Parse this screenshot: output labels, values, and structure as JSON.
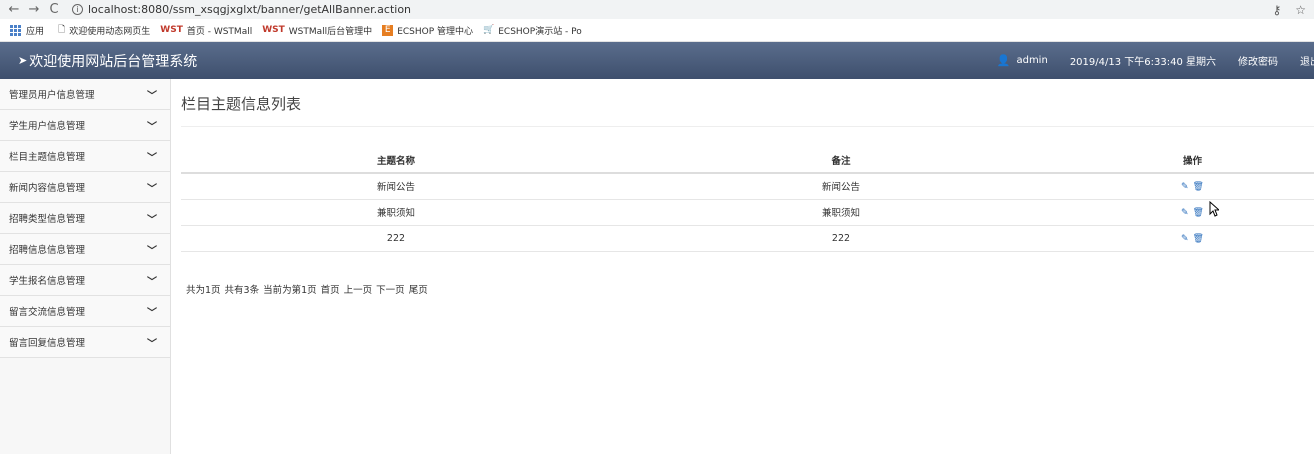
{
  "browser": {
    "url": "localhost:8080/ssm_xsqgjxglxt/banner/getAllBanner.action",
    "bookmarks": [
      {
        "label": "应用"
      },
      {
        "label": "欢迎使用动态网页生"
      },
      {
        "label": "首页 - WSTMall"
      },
      {
        "label": "WSTMall后台管理中"
      },
      {
        "label": "ECSHOP 管理中心"
      },
      {
        "label": "ECSHOP演示站 - Po"
      }
    ]
  },
  "header": {
    "title": "欢迎使用网站后台管理系统",
    "user": "admin",
    "datetime": "2019/4/13 下午6:33:40 星期六",
    "change_password": "修改密码",
    "logout": "退出"
  },
  "sidebar": {
    "items": [
      {
        "label": "管理员用户信息管理"
      },
      {
        "label": "学生用户信息管理"
      },
      {
        "label": "栏目主题信息管理"
      },
      {
        "label": "新闻内容信息管理"
      },
      {
        "label": "招聘类型信息管理"
      },
      {
        "label": "招聘信息信息管理"
      },
      {
        "label": "学生报名信息管理"
      },
      {
        "label": "留言交流信息管理"
      },
      {
        "label": "留言回复信息管理"
      }
    ]
  },
  "main": {
    "title": "栏目主题信息列表",
    "table": {
      "headers": [
        "主题名称",
        "备注",
        "操作"
      ],
      "rows": [
        {
          "name": "新闻公告",
          "remark": "新闻公告"
        },
        {
          "name": "兼职须知",
          "remark": "兼职须知"
        },
        {
          "name": "222",
          "remark": "222"
        }
      ]
    },
    "pager": {
      "total_pages": "共为1页",
      "total_records": "共有3条",
      "current": "当前为第1页",
      "first": "首页",
      "prev": "上一页",
      "next": "下一页",
      "last": "尾页"
    }
  },
  "colors": {
    "header_bg": "#4a5c7b",
    "link": "#2a6ebb"
  }
}
